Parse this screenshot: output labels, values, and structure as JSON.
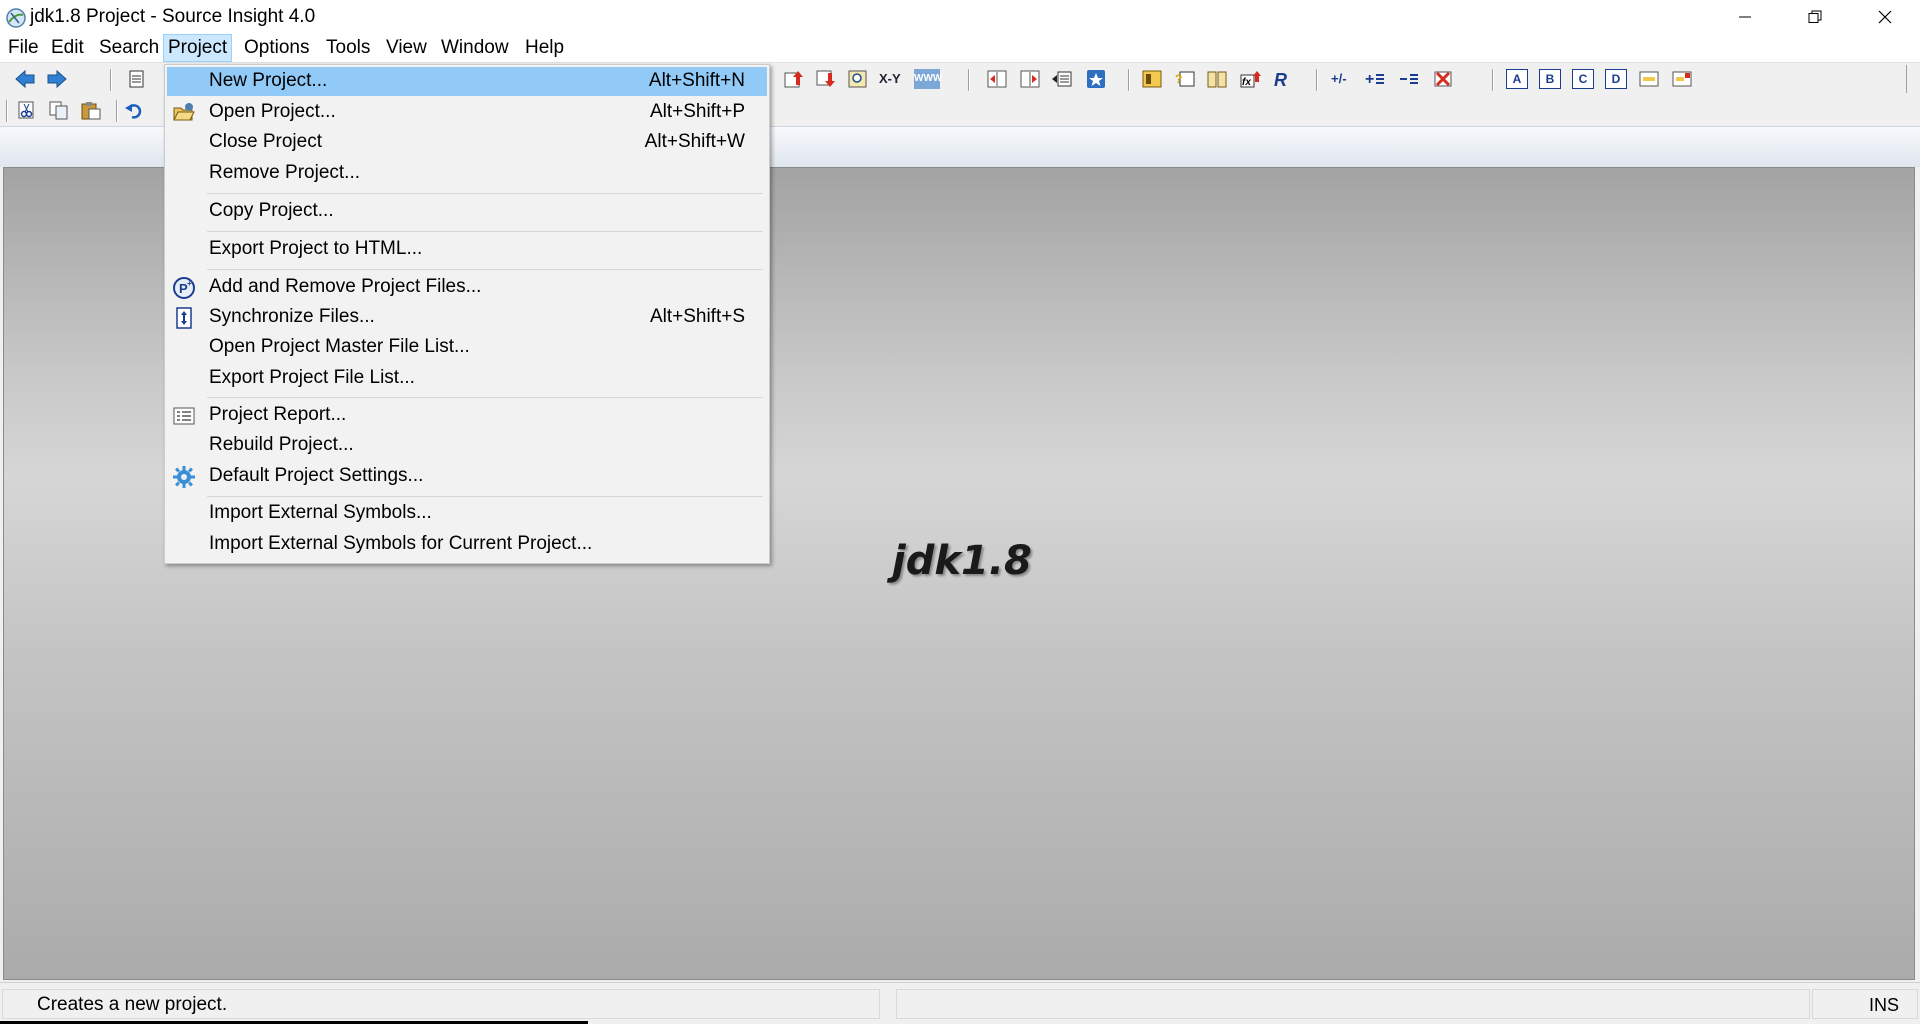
{
  "window": {
    "title": "jdk1.8 Project - Source Insight 4.0"
  },
  "menubar": {
    "items": [
      {
        "label": "File"
      },
      {
        "label": "Edit"
      },
      {
        "label": "Search"
      },
      {
        "label": "Project",
        "active": true
      },
      {
        "label": "Options"
      },
      {
        "label": "Tools"
      },
      {
        "label": "View"
      },
      {
        "label": "Window"
      },
      {
        "label": "Help"
      }
    ]
  },
  "toolbar": {
    "text_buttons": {
      "xy": "X-Y",
      "www": "WWW",
      "fx": "fx",
      "r": "R",
      "plus_minus": "+/-",
      "a": "A",
      "b": "B",
      "c": "C",
      "d": "D"
    }
  },
  "workspace": {
    "watermark": "jdk1.8"
  },
  "project_menu": {
    "items": [
      {
        "label": "New Project...",
        "shortcut": "Alt+Shift+N",
        "highlighted": true
      },
      {
        "label": "Open Project...",
        "shortcut": "Alt+Shift+P",
        "icon": "open-folder-icon"
      },
      {
        "label": "Close Project",
        "shortcut": "Alt+Shift+W"
      },
      {
        "label": "Remove Project..."
      },
      {
        "label": "Copy Project..."
      },
      {
        "label": "Export Project to HTML..."
      },
      {
        "label": "Add and Remove Project Files...",
        "icon": "project-files-icon"
      },
      {
        "label": "Synchronize Files...",
        "shortcut": "Alt+Shift+S",
        "icon": "sync-icon"
      },
      {
        "label": "Open Project Master File List..."
      },
      {
        "label": "Export Project File List..."
      },
      {
        "label": "Project Report...",
        "icon": "report-icon"
      },
      {
        "label": "Rebuild Project..."
      },
      {
        "label": "Default Project Settings...",
        "icon": "gear-icon"
      },
      {
        "label": "Import External Symbols..."
      },
      {
        "label": "Import External Symbols for Current Project..."
      }
    ]
  },
  "statusbar": {
    "message": "Creates a new project.",
    "mode": "INS"
  },
  "colors": {
    "menu_highlight": "#91c9f7",
    "menubar_active": "#cce8ff",
    "workspace_gray": "#c8c8c8"
  }
}
